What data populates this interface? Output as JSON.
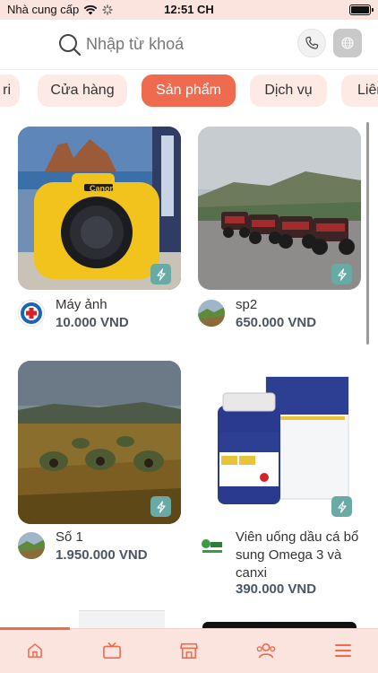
{
  "status_bar": {
    "carrier": "Nhà cung cấp",
    "time": "12:51 CH"
  },
  "header": {
    "search_placeholder": "Nhập từ khoá"
  },
  "tabs": [
    {
      "label": "ri"
    },
    {
      "label": "Cửa hàng"
    },
    {
      "label": "Sản phẩm",
      "active": true
    },
    {
      "label": "Dịch vụ"
    },
    {
      "label": "Liên"
    }
  ],
  "products": [
    {
      "name": "Máy ảnh",
      "price": "10.000 VND",
      "image": "yellow canon camera"
    },
    {
      "name": "sp2",
      "price": "650.000 VND",
      "image": "dune buggies on road"
    },
    {
      "name": "Số 1",
      "price": "1.950.000 VND",
      "image": "hobbit houses in field"
    },
    {
      "name_lines": [
        "Viên uống dầu cá bổ",
        "sung Omega 3 và",
        "canxi"
      ],
      "price": "390.000 VND",
      "image": "calcium supplement bottle and box"
    }
  ],
  "bottom_nav": [
    "home-icon",
    "tv-icon",
    "store-icon",
    "people-icon",
    "menu-icon"
  ],
  "colors": {
    "accent": "#ef6b50",
    "tab_bg": "#fdeae4",
    "nav_bg": "#fbe4de",
    "flash_btn": "#6aaaa5",
    "price": "#4c5562"
  }
}
